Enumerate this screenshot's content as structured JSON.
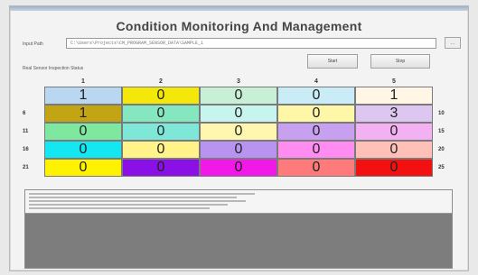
{
  "title": "Condition Monitoring And Management",
  "file_label": "Input Path",
  "file_path": "C:\\Users\\Projects\\CM_PROGRAM_SENSOR_DATA\\SAMPLE_1",
  "browse_label": "...",
  "grid_label": "Real Sensor Inspection Status",
  "buttons": {
    "start": "Start",
    "stop": "Stop"
  },
  "column_headers": [
    "1",
    "2",
    "3",
    "4",
    "5"
  ],
  "row_headers_left": [
    "",
    "6",
    "11",
    "16",
    "21"
  ],
  "row_headers_right": [
    "",
    "10",
    "15",
    "20",
    "25"
  ],
  "grid": [
    [
      {
        "v": "1",
        "bg": "#b9d7f0"
      },
      {
        "v": "0",
        "bg": "#f3e80a"
      },
      {
        "v": "0",
        "bg": "#c8f0d6"
      },
      {
        "v": "0",
        "bg": "#c9ecf7"
      },
      {
        "v": "1",
        "bg": "#fff6e6"
      }
    ],
    [
      {
        "v": "1",
        "bg": "#c2a415"
      },
      {
        "v": "0",
        "bg": "#85e7c0"
      },
      {
        "v": "0",
        "bg": "#c7f4ec"
      },
      {
        "v": "0",
        "bg": "#fff7a8"
      },
      {
        "v": "3",
        "bg": "#ddc6f0"
      }
    ],
    [
      {
        "v": "0",
        "bg": "#7fe8a0"
      },
      {
        "v": "0",
        "bg": "#7fe7d8"
      },
      {
        "v": "0",
        "bg": "#fff6b0"
      },
      {
        "v": "0",
        "bg": "#c8a0f0"
      },
      {
        "v": "0",
        "bg": "#f3b0f3"
      }
    ],
    [
      {
        "v": "0",
        "bg": "#13e7f2"
      },
      {
        "v": "0",
        "bg": "#fff38a"
      },
      {
        "v": "0",
        "bg": "#b893f0"
      },
      {
        "v": "0",
        "bg": "#ff8cf0"
      },
      {
        "v": "0",
        "bg": "#ffc0b8"
      }
    ],
    [
      {
        "v": "0",
        "bg": "#fff200"
      },
      {
        "v": "0",
        "bg": "#8a10e6"
      },
      {
        "v": "0",
        "bg": "#f218e8"
      },
      {
        "v": "0",
        "bg": "#ff7a7a"
      },
      {
        "v": "0",
        "bg": "#f21010"
      }
    ]
  ],
  "log_line_count": 5
}
